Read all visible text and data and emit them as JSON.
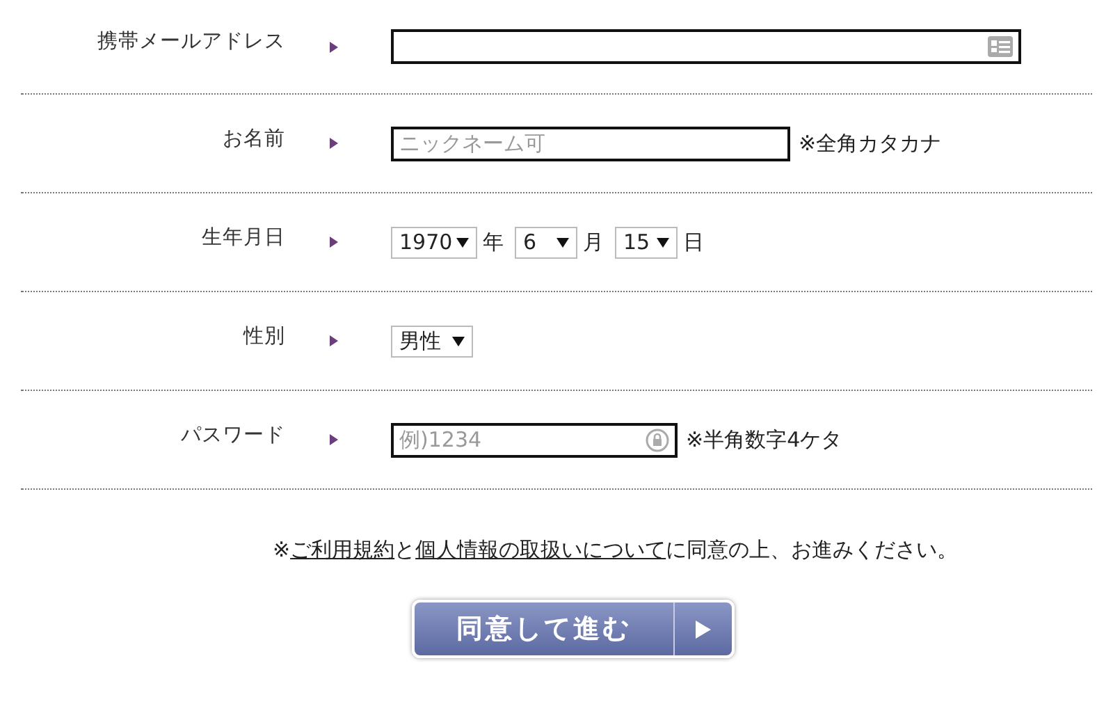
{
  "rows": [
    {
      "label": "携帯メールアドレス",
      "kind": "email"
    },
    {
      "label": "お名前",
      "kind": "name",
      "placeholder": "ニックネーム可",
      "note": "※全角カタカナ"
    },
    {
      "label": "生年月日",
      "kind": "selects",
      "selects": [
        {
          "value": "1970",
          "unit": "年"
        },
        {
          "value": "6",
          "unit": "月"
        },
        {
          "value": "15",
          "unit": "日"
        }
      ]
    },
    {
      "label": "性別",
      "kind": "selects",
      "selects": [
        {
          "value": "男性"
        }
      ]
    },
    {
      "label": "パスワード",
      "kind": "password",
      "placeholder": "例)1234",
      "note": "※半角数字4ケタ"
    }
  ],
  "agreement": [
    {
      "kind": "text",
      "text": "※"
    },
    {
      "kind": "link",
      "text": "ご利用規約"
    },
    {
      "kind": "text",
      "text": "と"
    },
    {
      "kind": "link",
      "text": "個人情報の取扱いについて"
    },
    {
      "kind": "text",
      "text": "に同意の上、お進みください。"
    }
  ],
  "submit": {
    "label": "同意して進む"
  }
}
